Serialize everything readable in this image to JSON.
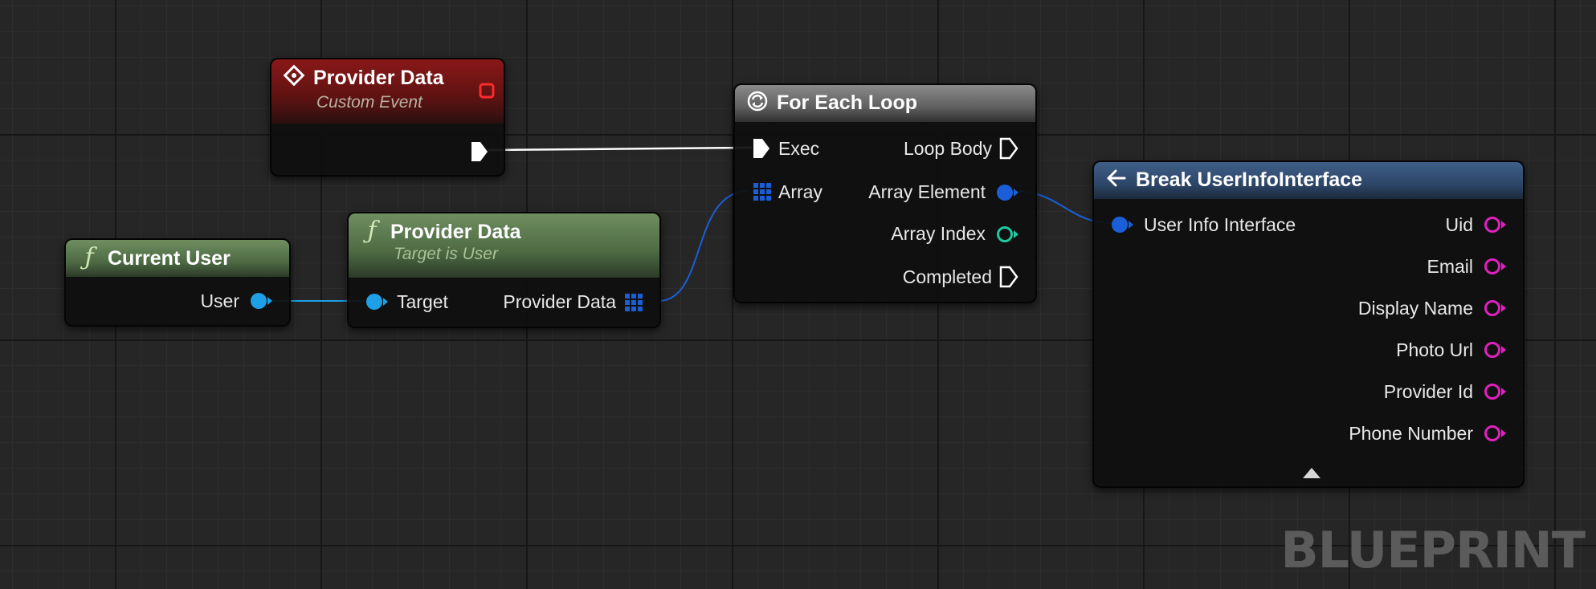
{
  "watermark": "BLUEPRINT",
  "colors": {
    "exec": "#ffffff",
    "object": "#1ea0e8",
    "struct_pin": "#1a5fd8",
    "string_pin": "#e020c0",
    "int_pin": "#1fc8a0"
  },
  "nodes": {
    "custom_event": {
      "icon": "custom-event-icon",
      "title": "Provider Data",
      "subtitle": "Custom Event"
    },
    "current_user": {
      "icon": "function-icon",
      "title": "Current User",
      "pins": {
        "user": "User"
      }
    },
    "provider_data_func": {
      "icon": "function-icon",
      "title": "Provider Data",
      "subtitle": "Target is User",
      "pins": {
        "target": "Target",
        "provider_data": "Provider Data"
      }
    },
    "for_each": {
      "icon": "loop-icon",
      "title": "For Each Loop",
      "pins": {
        "exec": "Exec",
        "array": "Array",
        "loop_body": "Loop Body",
        "array_element": "Array Element",
        "array_index": "Array Index",
        "completed": "Completed"
      }
    },
    "break_struct": {
      "icon": "break-struct-icon",
      "title": "Break UserInfoInterface",
      "pins": {
        "user_info_interface": "User Info Interface",
        "uid": "Uid",
        "email": "Email",
        "display_name": "Display Name",
        "photo_url": "Photo Url",
        "provider_id": "Provider Id",
        "phone_number": "Phone Number"
      }
    }
  }
}
